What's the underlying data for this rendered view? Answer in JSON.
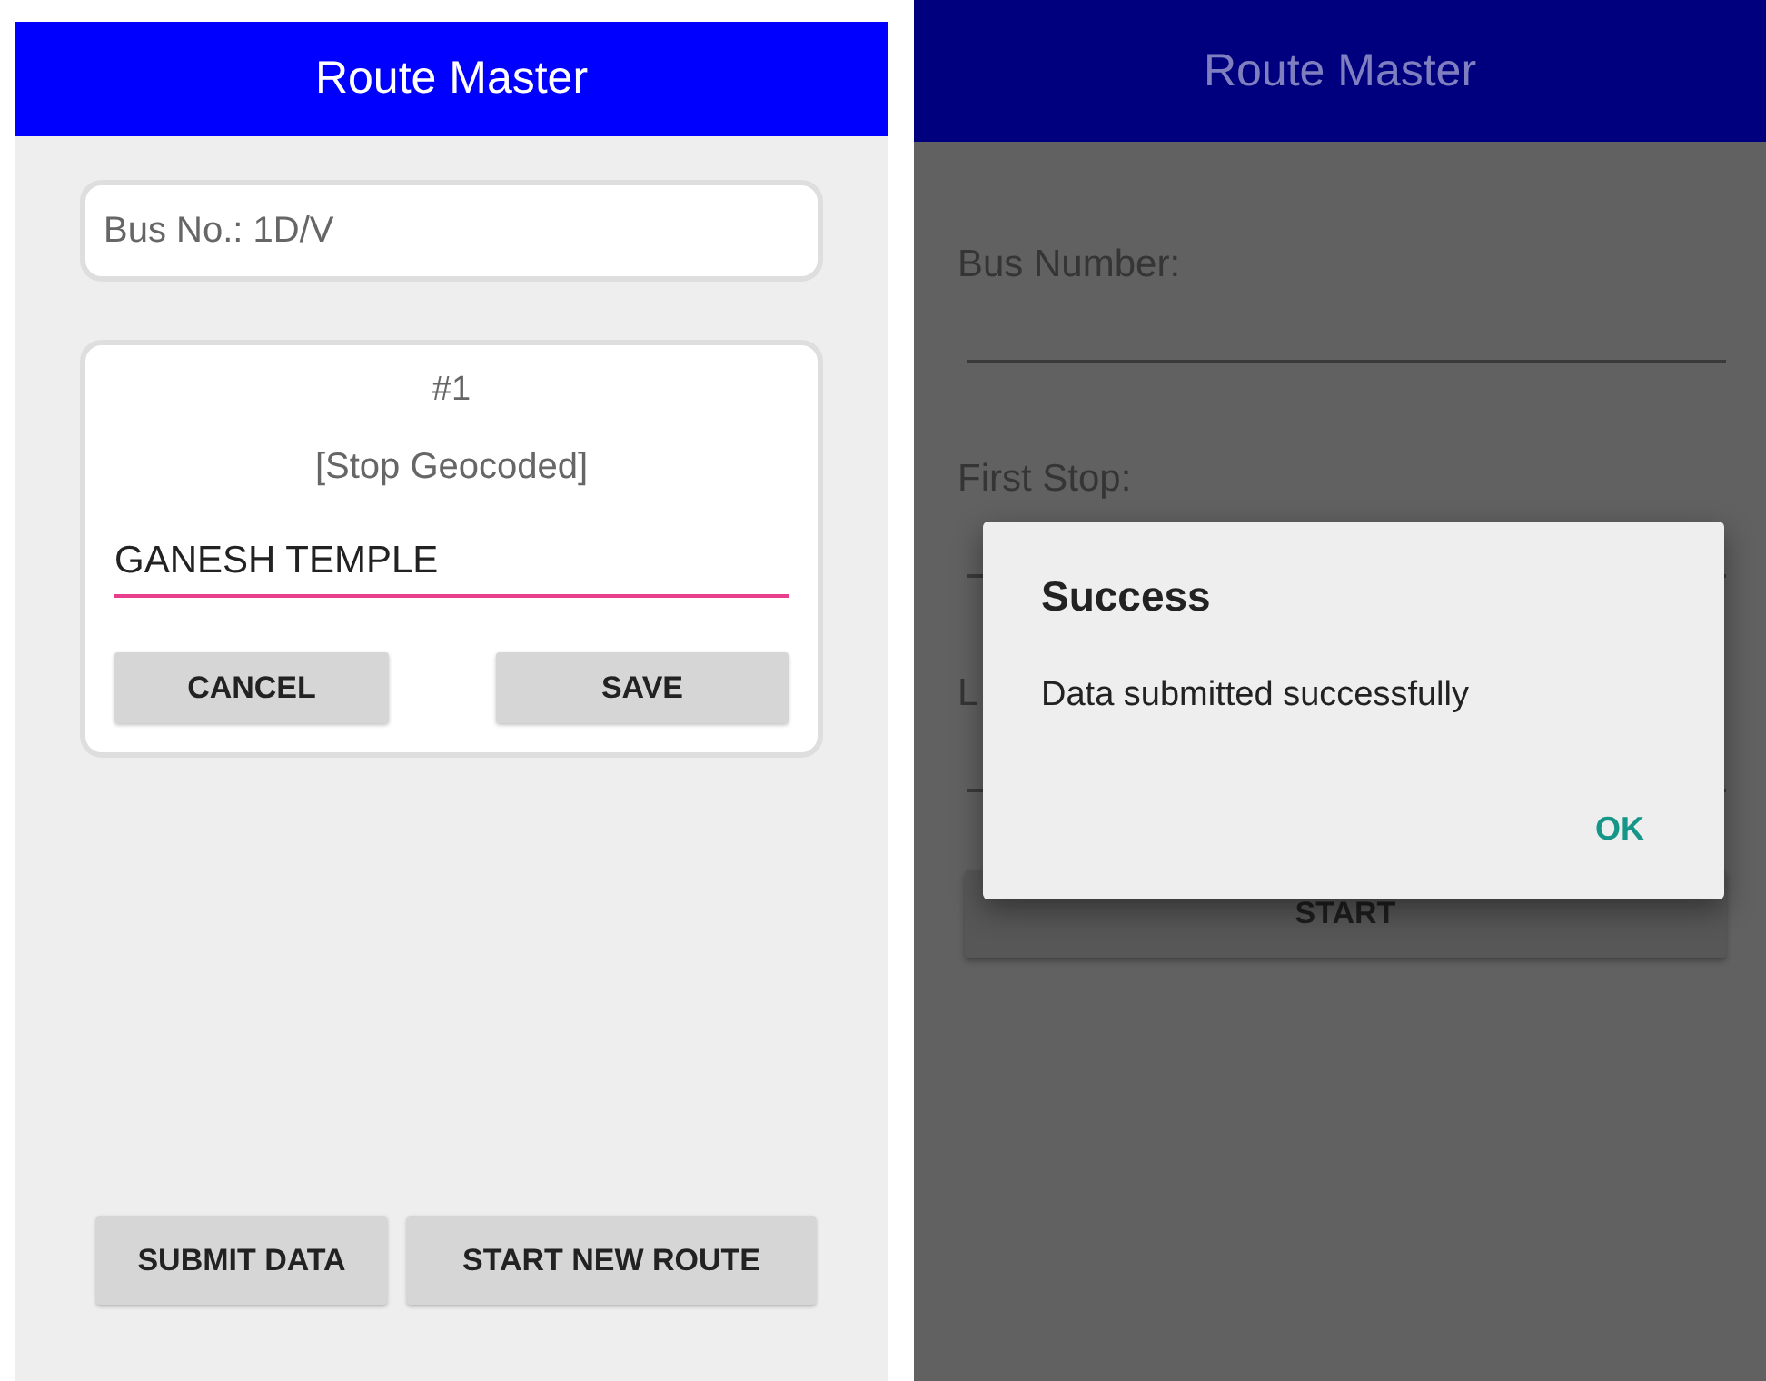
{
  "left_screen": {
    "app_bar": {
      "title": "Route Master"
    },
    "bus_label": "Bus No.: 1D/V",
    "stop_card": {
      "number": "#1",
      "status": "[Stop Geocoded]",
      "stop_name": {
        "value": "GANESH TEMPLE",
        "focused": true
      },
      "buttons": [
        "CANCEL",
        "SAVE"
      ]
    },
    "bottom_buttons": [
      "SUBMIT DATA",
      "START NEW ROUTE"
    ]
  },
  "right_screen": {
    "app_bar": {
      "title": "Route Master"
    },
    "fields": [
      {
        "label": "Bus Number:"
      },
      {
        "label": "First Stop:"
      },
      {
        "label": "L"
      }
    ],
    "start_button": "START",
    "dialog": {
      "title": "Success",
      "message": "Data submitted successfully",
      "button": "OK"
    }
  }
}
